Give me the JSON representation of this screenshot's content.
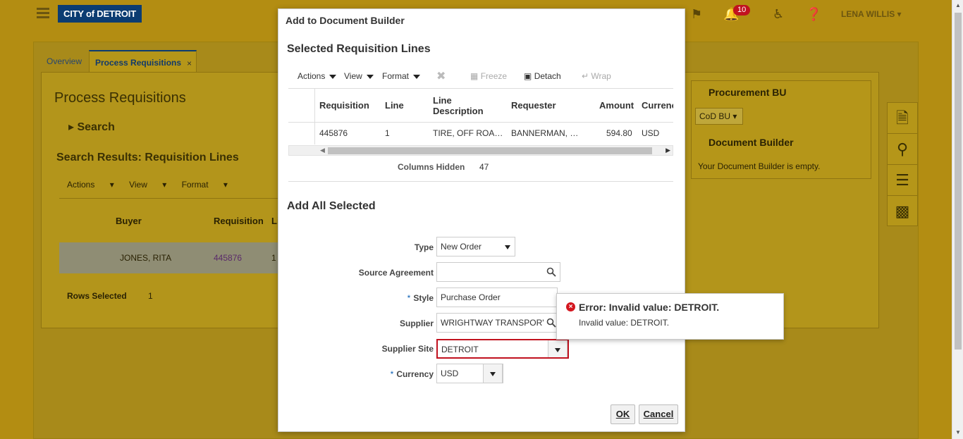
{
  "header": {
    "brand": "CITY of DETROIT",
    "notification_count": "10",
    "user_name": "LENA WILLIS"
  },
  "tabs": [
    {
      "label": "Overview"
    },
    {
      "label": "Process Requisitions"
    }
  ],
  "page": {
    "title": "Process Requisitions",
    "search_label": "Search",
    "results_title": "Search Results: Requisition Lines",
    "toolbar": {
      "actions": "Actions",
      "view": "View",
      "format": "Format"
    },
    "columns": {
      "buyer": "Buyer",
      "requisition": "Requisition",
      "line": "Li"
    },
    "row": {
      "buyer": "JONES, RITA",
      "requisition": "445876",
      "line": "1"
    },
    "rows_selected_label": "Rows Selected",
    "rows_selected_value": "1"
  },
  "right_panel": {
    "procurement_bu_title": "Procurement BU",
    "procurement_bu_value": "CoD BU",
    "doc_builder_title": "Document Builder",
    "doc_builder_empty": "Your Document Builder is empty."
  },
  "dialog": {
    "title": "Add to Document Builder",
    "selected_section": "Selected Requisition Lines",
    "toolbar": {
      "actions": "Actions",
      "view": "View",
      "format": "Format",
      "freeze": "Freeze",
      "detach": "Detach",
      "wrap": "Wrap"
    },
    "columns": {
      "requisition": "Requisition",
      "line": "Line",
      "line_description_1": "Line",
      "line_description_2": "Description",
      "requester": "Requester",
      "amount": "Amount",
      "currency": "Currenc"
    },
    "row": {
      "requisition": "445876",
      "line": "1",
      "line_description": "TIRE, OFF ROA…",
      "requester": "BANNERMAN, …",
      "amount": "594.80",
      "currency": "USD"
    },
    "columns_hidden_label": "Columns Hidden",
    "columns_hidden_value": "47",
    "add_section": "Add All Selected",
    "form": {
      "type_label": "Type",
      "type_value": "New Order",
      "source_agreement_label": "Source Agreement",
      "source_agreement_value": "",
      "style_label": "Style",
      "style_value": "Purchase Order",
      "supplier_label": "Supplier",
      "supplier_value": "WRIGHTWAY TRANSPOR'",
      "supplier_site_label": "Supplier Site",
      "supplier_site_value": "DETROIT",
      "currency_label": "Currency",
      "currency_value": "USD",
      "required_mark": "*"
    },
    "error": {
      "title": "Error: Invalid value: DETROIT.",
      "message": "Invalid value: DETROIT."
    },
    "ok_label": "OK",
    "cancel_label": "Cancel"
  },
  "colors": {
    "header_gold": "#b38d12",
    "brand_blue": "#0b3c72",
    "error_red": "#c1121f"
  }
}
